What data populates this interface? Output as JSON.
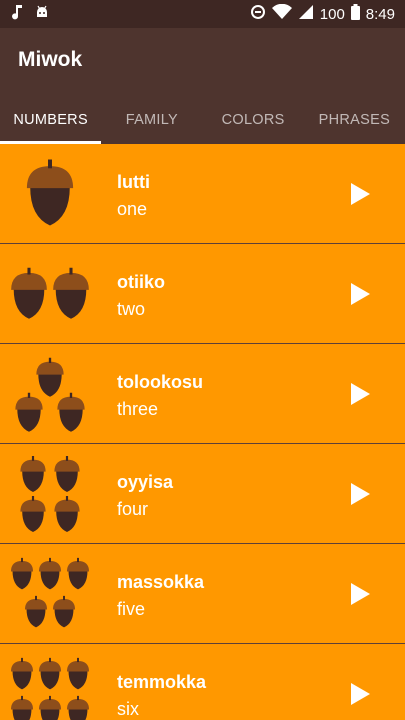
{
  "status_bar": {
    "battery": "100",
    "time": "8:49",
    "icons": [
      "music-note-icon",
      "android-icon",
      "data-saver-icon",
      "wifi-icon",
      "signal-icon",
      "battery-icon"
    ]
  },
  "app": {
    "title": "Miwok"
  },
  "tabs": [
    {
      "label": "NUMBERS",
      "active": true
    },
    {
      "label": "FAMILY",
      "active": false
    },
    {
      "label": "COLORS",
      "active": false
    },
    {
      "label": "PHRASES",
      "active": false
    }
  ],
  "colors": {
    "primary": "#4E342E",
    "primary_dark": "#3E2723",
    "item_background": "#FF9800",
    "acorn_cap": "#8D4E1B",
    "acorn_body": "#3E2723"
  },
  "words": [
    {
      "miwok": "lutti",
      "english": "one",
      "acorns": 1,
      "icon": "acorn-icon"
    },
    {
      "miwok": "otiiko",
      "english": "two",
      "acorns": 2,
      "icon": "acorn-icon"
    },
    {
      "miwok": "tolookosu",
      "english": "three",
      "acorns": 3,
      "icon": "acorn-icon"
    },
    {
      "miwok": "oyyisa",
      "english": "four",
      "acorns": 4,
      "icon": "acorn-icon"
    },
    {
      "miwok": "massokka",
      "english": "five",
      "acorns": 5,
      "icon": "acorn-icon"
    },
    {
      "miwok": "temmokka",
      "english": "six",
      "acorns": 6,
      "icon": "acorn-icon"
    }
  ]
}
